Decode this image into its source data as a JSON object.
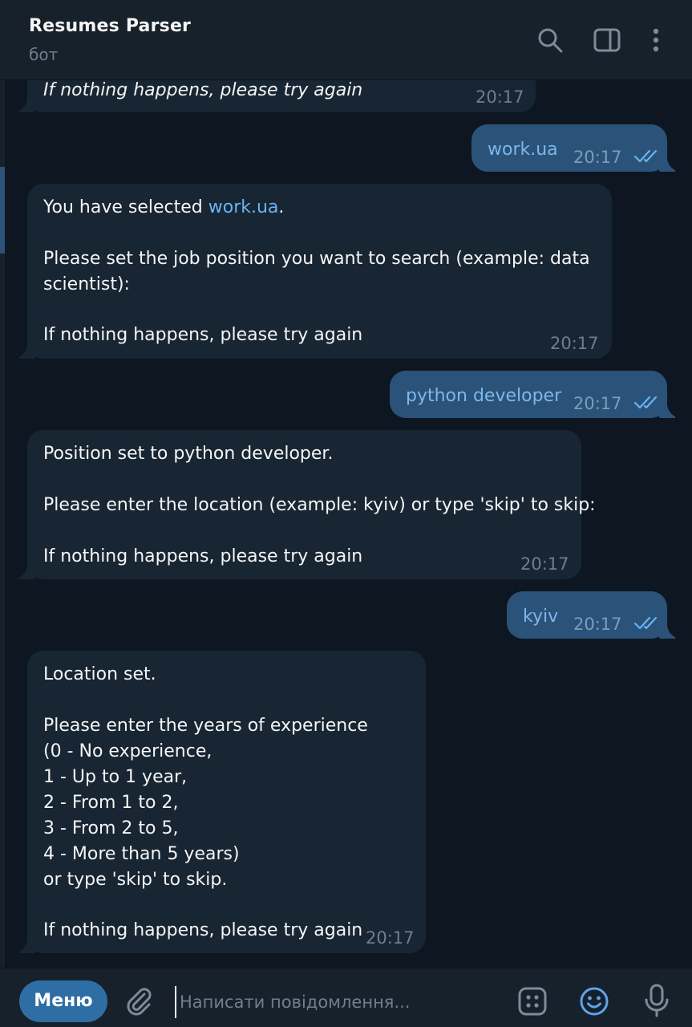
{
  "header": {
    "title": "Resumes Parser",
    "subtitle": "бот"
  },
  "messages": [
    {
      "direction": "in",
      "text": "If nothing happens, please try again",
      "time": "20:17"
    },
    {
      "direction": "out",
      "text": "work.ua",
      "time": "20:17",
      "status": "read"
    },
    {
      "direction": "in",
      "text_before_link": "You have selected ",
      "link": "work.ua",
      "text_after_link": ".",
      "line2": "Please set the job position you want to search (example: data",
      "line3": "scientist):",
      "line4": "If nothing happens, please try again",
      "time": "20:17"
    },
    {
      "direction": "out",
      "text": "python developer",
      "time": "20:17",
      "status": "read"
    },
    {
      "direction": "in",
      "line1": "Position set to python developer.",
      "line2": "Please enter the location (example: kyiv) or type 'skip' to skip:",
      "line3": "If nothing happens, please try again",
      "time": "20:17"
    },
    {
      "direction": "out",
      "text": "kyiv",
      "time": "20:17",
      "status": "read"
    },
    {
      "direction": "in",
      "line1": "Location set.",
      "line2": "Please enter the years of experience",
      "line3": "(0 - No experience,",
      "line4": "1 - Up to 1 year,",
      "line5": "2 - From 1 to 2,",
      "line6": "3 - From 2 to 5,",
      "line7": "4 - More than 5 years)",
      "line8": "or type 'skip' to skip.",
      "line9": "If nothing happens, please try again",
      "time": "20:17"
    }
  ],
  "composer": {
    "menu_label": "Меню",
    "placeholder": "Написати повідомлення..."
  },
  "icons": {
    "header": [
      "search-icon",
      "sidebar-toggle-icon",
      "more-vertical-icon"
    ],
    "composer": [
      "attach-icon",
      "bot-commands-icon",
      "emoji-icon",
      "microphone-icon"
    ],
    "read_status": "double-check-icon"
  },
  "colors": {
    "background": "#0e1621",
    "header": "#17212b",
    "incoming_bubble": "#182533",
    "outgoing_bubble": "#2b5278",
    "link": "#6ab3f3",
    "accent": "#2f6ea5",
    "muted": "#6d7f8f"
  }
}
